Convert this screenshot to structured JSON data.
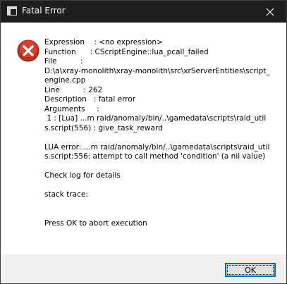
{
  "window": {
    "title": "Fatal Error",
    "close_icon": "close-icon"
  },
  "dialog": {
    "icon": "error-icon",
    "message": "Expression    : <no expression>\nFunction      : CScriptEngine::lua_pcall_failed\nFile          :\nD:\\a\\xray-monolith\\xray-monolith\\src\\xrServerEntities\\script_engine.cpp\nLine          : 262\nDescription   : fatal error\nArguments     :\n 1 : [Lua] ...m raid/anomaly/bin/..\\gamedata\\scripts\\raid_utils.script(556) : give_task_reward\n\nLUA error: ...m raid/anomaly/bin/..\\gamedata\\scripts\\raid_utils.script:556: attempt to call method 'condition' (a nil value)\n\nCheck log for details\n\nstack trace:\n\n\nPress OK to abort execution"
  },
  "footer": {
    "ok_label": "OK"
  },
  "colors": {
    "titlebar": "#1f1f1f",
    "error_red": "#d42a2a",
    "focus_border": "#0067c0"
  }
}
